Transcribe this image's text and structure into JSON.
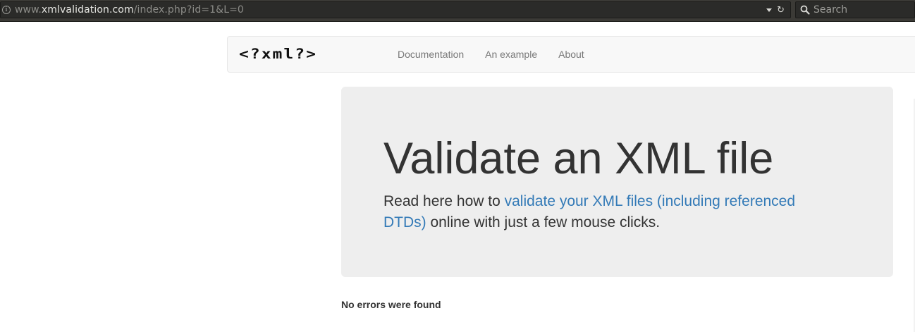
{
  "browser": {
    "url_prefix": "www.",
    "url_domain": "xmlvalidation.com",
    "url_path": "/index.php?id=1&L=0",
    "search_placeholder": "Search"
  },
  "navbar": {
    "brand": "<?xml?>",
    "links": [
      {
        "label": "Documentation"
      },
      {
        "label": "An example"
      },
      {
        "label": "About"
      }
    ]
  },
  "jumbotron": {
    "title": "Validate an XML file",
    "text_before": "Read here how to ",
    "link_text": "validate your XML files (including referenced DTDs)",
    "text_after": " online with just a few mouse clicks."
  },
  "status": {
    "message": "No errors were found"
  },
  "colors": {
    "link": "#337ab7",
    "jumbotron_bg": "#eeeeee",
    "navbar_bg": "#f8f8f8"
  }
}
